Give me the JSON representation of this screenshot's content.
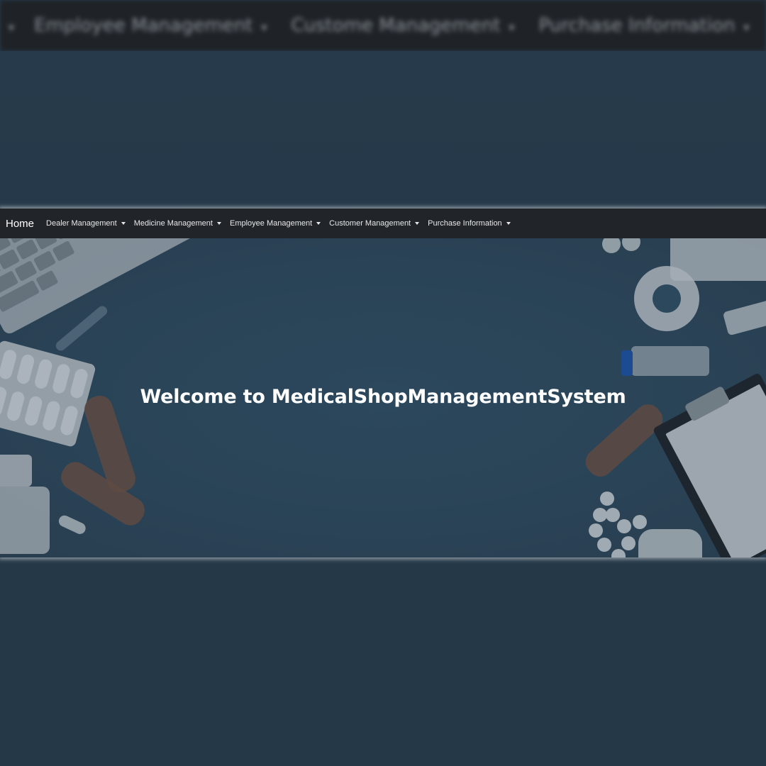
{
  "backdrop": {
    "nav_items": [
      "Employee Management",
      "Custome Management",
      "Purchase Information"
    ]
  },
  "navbar": {
    "brand": "Home",
    "menus": [
      {
        "label": "Dealer Management"
      },
      {
        "label": "Medicine Management"
      },
      {
        "label": "Employee Management"
      },
      {
        "label": "Customer Management"
      },
      {
        "label": "Purchase Information"
      }
    ]
  },
  "hero": {
    "title": "Welcome to MedicalShopManagementSystem"
  },
  "colors": {
    "navbar_bg": "#212529",
    "hero_bg": "#2c4558",
    "text": "#ffffff"
  },
  "icons": [
    "chevron-down-icon"
  ]
}
